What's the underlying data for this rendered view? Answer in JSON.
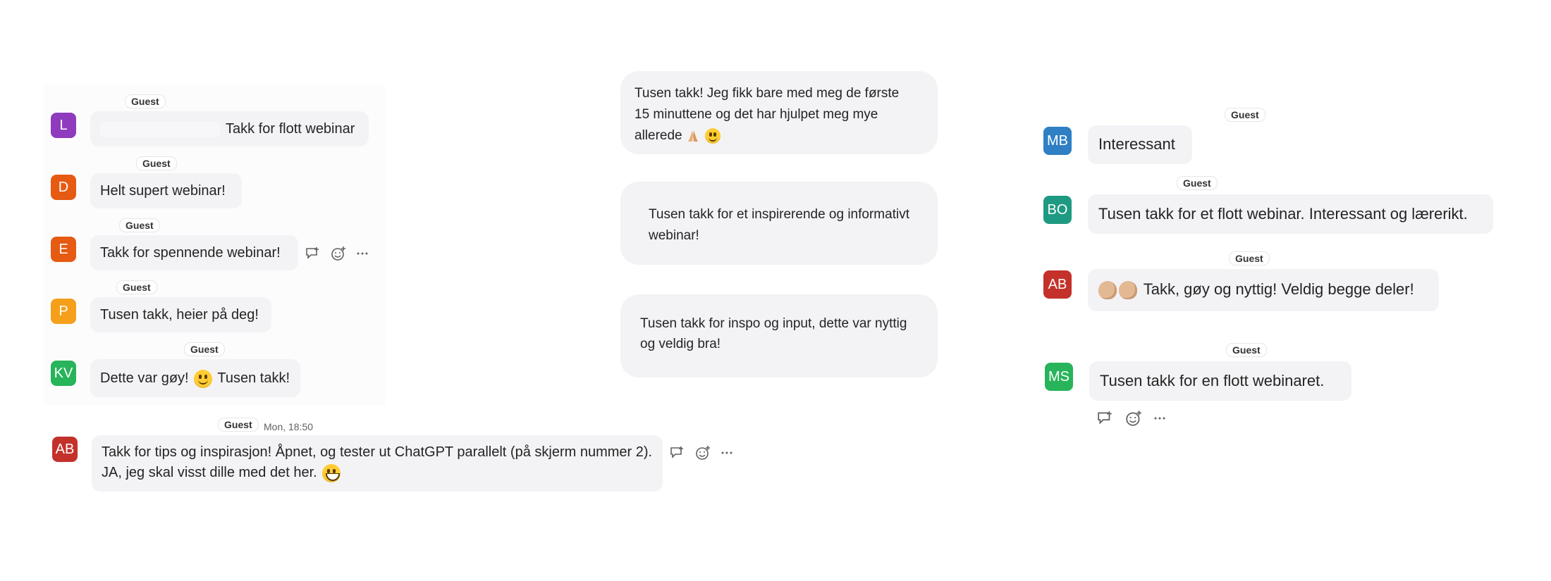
{
  "colors": {
    "bubble_bg": "#f3f3f6",
    "avatar_purple": "#8e3bbd",
    "avatar_orange": "#e65a12",
    "avatar_amber": "#f59f1a",
    "avatar_green": "#27b45a",
    "avatar_red": "#c4312b",
    "avatar_blue": "#2e7fc4",
    "avatar_teal": "#1e9a82"
  },
  "left_panel": {
    "messages": [
      {
        "initials": "L",
        "tag": "Guest",
        "text": "Takk for flott webinar"
      },
      {
        "initials": "D",
        "tag": "Guest",
        "text": "Helt supert webinar!"
      },
      {
        "initials": "E",
        "tag": "Guest",
        "text": "Takk for spennende webinar!"
      },
      {
        "initials": "P",
        "tag": "Guest",
        "text": "Tusen takk, heier på deg!"
      },
      {
        "initials": "KV",
        "tag": "Guest",
        "text_before": "Dette var gøy!",
        "emoji": "slightly-smiling-face",
        "text_after": "Tusen takk!"
      }
    ],
    "long_message": {
      "initials": "AB",
      "tag": "Guest",
      "time": "Mon, 18:50",
      "line1": "Takk for tips og inspirasjon! Åpnet, og tester ut ChatGPT parallelt (på skjerm nummer 2).",
      "line2": "JA, jeg skal visst dille med det her.",
      "emoji": "grinning-face"
    }
  },
  "middle_panel": {
    "cards": [
      {
        "line1": "Tusen takk! Jeg fikk bare med meg de første",
        "line2": "15 minuttene og det har hjulpet meg mye",
        "line3": "allerede",
        "emoji": "folded-hands smiling-face"
      },
      {
        "line1": "Tusen takk for et inspirerende og informativt",
        "line2": "webinar!"
      },
      {
        "line1": "Tusen takk for inspo og input, dette var nyttig",
        "line2": "og veldig bra!"
      }
    ]
  },
  "right_panel": {
    "messages": [
      {
        "initials": "MB",
        "tag": "Guest",
        "text": "Interessant"
      },
      {
        "initials": "BO",
        "tag": "Guest",
        "text": "Tusen takk for et flott webinar. Interessant og lærerikt."
      },
      {
        "initials": "AB",
        "tag": "Guest",
        "emoji": "clapping-hands clapping-hands",
        "text": "Takk, gøy og nyttig! Veldig begge deler!"
      },
      {
        "initials": "MS",
        "tag": "Guest",
        "text": "Tusen takk for en flott webinaret."
      }
    ]
  },
  "icons": {
    "reply": "reply-icon",
    "react": "add-reaction-icon",
    "more": "more-options-icon"
  }
}
